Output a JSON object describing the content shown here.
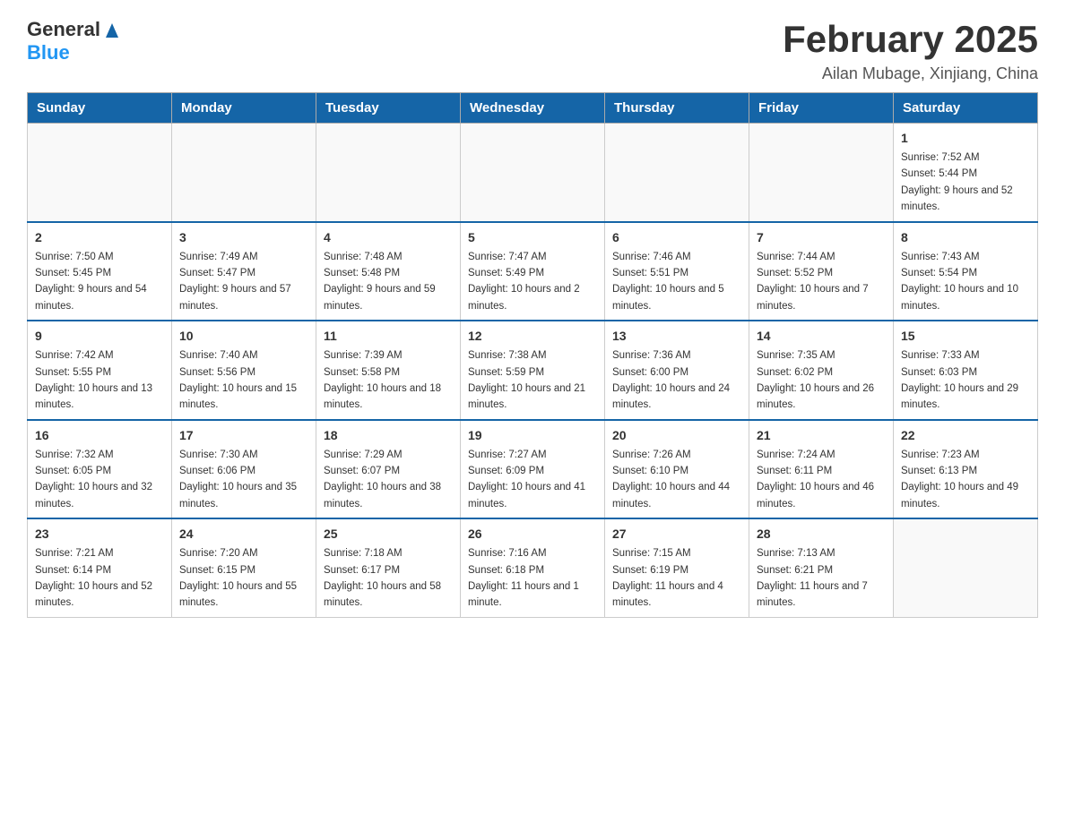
{
  "header": {
    "logo_general": "General",
    "logo_blue": "Blue",
    "month_title": "February 2025",
    "subtitle": "Ailan Mubage, Xinjiang, China"
  },
  "days_of_week": [
    "Sunday",
    "Monday",
    "Tuesday",
    "Wednesday",
    "Thursday",
    "Friday",
    "Saturday"
  ],
  "weeks": [
    [
      {
        "day": "",
        "info": ""
      },
      {
        "day": "",
        "info": ""
      },
      {
        "day": "",
        "info": ""
      },
      {
        "day": "",
        "info": ""
      },
      {
        "day": "",
        "info": ""
      },
      {
        "day": "",
        "info": ""
      },
      {
        "day": "1",
        "info": "Sunrise: 7:52 AM\nSunset: 5:44 PM\nDaylight: 9 hours and 52 minutes."
      }
    ],
    [
      {
        "day": "2",
        "info": "Sunrise: 7:50 AM\nSunset: 5:45 PM\nDaylight: 9 hours and 54 minutes."
      },
      {
        "day": "3",
        "info": "Sunrise: 7:49 AM\nSunset: 5:47 PM\nDaylight: 9 hours and 57 minutes."
      },
      {
        "day": "4",
        "info": "Sunrise: 7:48 AM\nSunset: 5:48 PM\nDaylight: 9 hours and 59 minutes."
      },
      {
        "day": "5",
        "info": "Sunrise: 7:47 AM\nSunset: 5:49 PM\nDaylight: 10 hours and 2 minutes."
      },
      {
        "day": "6",
        "info": "Sunrise: 7:46 AM\nSunset: 5:51 PM\nDaylight: 10 hours and 5 minutes."
      },
      {
        "day": "7",
        "info": "Sunrise: 7:44 AM\nSunset: 5:52 PM\nDaylight: 10 hours and 7 minutes."
      },
      {
        "day": "8",
        "info": "Sunrise: 7:43 AM\nSunset: 5:54 PM\nDaylight: 10 hours and 10 minutes."
      }
    ],
    [
      {
        "day": "9",
        "info": "Sunrise: 7:42 AM\nSunset: 5:55 PM\nDaylight: 10 hours and 13 minutes."
      },
      {
        "day": "10",
        "info": "Sunrise: 7:40 AM\nSunset: 5:56 PM\nDaylight: 10 hours and 15 minutes."
      },
      {
        "day": "11",
        "info": "Sunrise: 7:39 AM\nSunset: 5:58 PM\nDaylight: 10 hours and 18 minutes."
      },
      {
        "day": "12",
        "info": "Sunrise: 7:38 AM\nSunset: 5:59 PM\nDaylight: 10 hours and 21 minutes."
      },
      {
        "day": "13",
        "info": "Sunrise: 7:36 AM\nSunset: 6:00 PM\nDaylight: 10 hours and 24 minutes."
      },
      {
        "day": "14",
        "info": "Sunrise: 7:35 AM\nSunset: 6:02 PM\nDaylight: 10 hours and 26 minutes."
      },
      {
        "day": "15",
        "info": "Sunrise: 7:33 AM\nSunset: 6:03 PM\nDaylight: 10 hours and 29 minutes."
      }
    ],
    [
      {
        "day": "16",
        "info": "Sunrise: 7:32 AM\nSunset: 6:05 PM\nDaylight: 10 hours and 32 minutes."
      },
      {
        "day": "17",
        "info": "Sunrise: 7:30 AM\nSunset: 6:06 PM\nDaylight: 10 hours and 35 minutes."
      },
      {
        "day": "18",
        "info": "Sunrise: 7:29 AM\nSunset: 6:07 PM\nDaylight: 10 hours and 38 minutes."
      },
      {
        "day": "19",
        "info": "Sunrise: 7:27 AM\nSunset: 6:09 PM\nDaylight: 10 hours and 41 minutes."
      },
      {
        "day": "20",
        "info": "Sunrise: 7:26 AM\nSunset: 6:10 PM\nDaylight: 10 hours and 44 minutes."
      },
      {
        "day": "21",
        "info": "Sunrise: 7:24 AM\nSunset: 6:11 PM\nDaylight: 10 hours and 46 minutes."
      },
      {
        "day": "22",
        "info": "Sunrise: 7:23 AM\nSunset: 6:13 PM\nDaylight: 10 hours and 49 minutes."
      }
    ],
    [
      {
        "day": "23",
        "info": "Sunrise: 7:21 AM\nSunset: 6:14 PM\nDaylight: 10 hours and 52 minutes."
      },
      {
        "day": "24",
        "info": "Sunrise: 7:20 AM\nSunset: 6:15 PM\nDaylight: 10 hours and 55 minutes."
      },
      {
        "day": "25",
        "info": "Sunrise: 7:18 AM\nSunset: 6:17 PM\nDaylight: 10 hours and 58 minutes."
      },
      {
        "day": "26",
        "info": "Sunrise: 7:16 AM\nSunset: 6:18 PM\nDaylight: 11 hours and 1 minute."
      },
      {
        "day": "27",
        "info": "Sunrise: 7:15 AM\nSunset: 6:19 PM\nDaylight: 11 hours and 4 minutes."
      },
      {
        "day": "28",
        "info": "Sunrise: 7:13 AM\nSunset: 6:21 PM\nDaylight: 11 hours and 7 minutes."
      },
      {
        "day": "",
        "info": ""
      }
    ]
  ]
}
